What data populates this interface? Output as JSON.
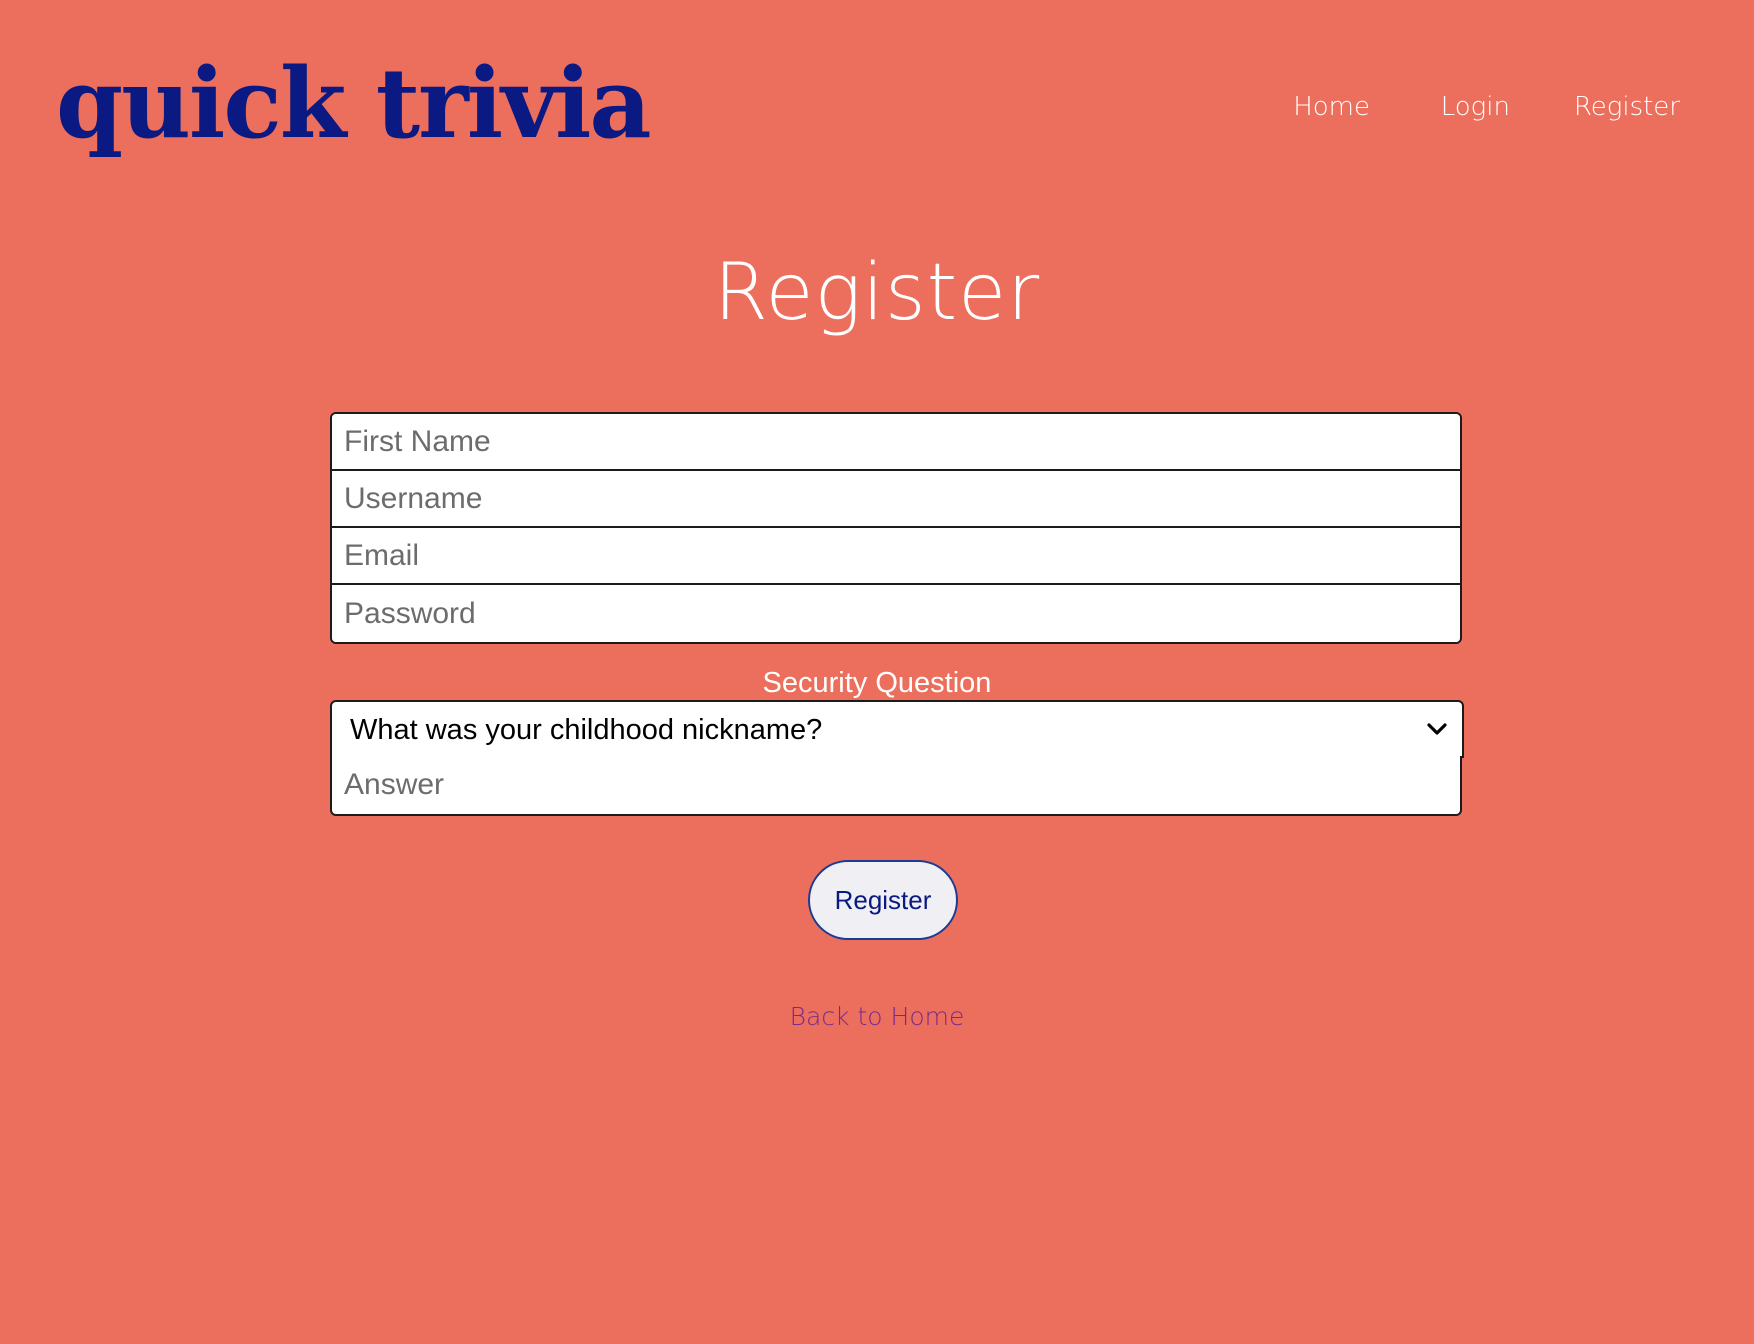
{
  "brand": {
    "logo_text": "quick trivia",
    "colors": {
      "background": "#ec6f5d",
      "logo": "#0a1a82",
      "link": "#7a2a8c"
    }
  },
  "nav": {
    "items": [
      {
        "label": "Home"
      },
      {
        "label": "Login"
      },
      {
        "label": "Register"
      }
    ]
  },
  "form": {
    "title": "Register",
    "fields": {
      "first_name": {
        "placeholder": "First Name"
      },
      "username": {
        "placeholder": "Username"
      },
      "email": {
        "placeholder": "Email"
      },
      "password": {
        "placeholder": "Password"
      }
    },
    "security": {
      "label": "Security Question",
      "selected": "What was your childhood nickname?",
      "answer_placeholder": "Answer"
    },
    "submit_label": "Register",
    "back_link": "Back to Home"
  },
  "icons": {
    "select_arrow": "chevron-down-icon"
  }
}
